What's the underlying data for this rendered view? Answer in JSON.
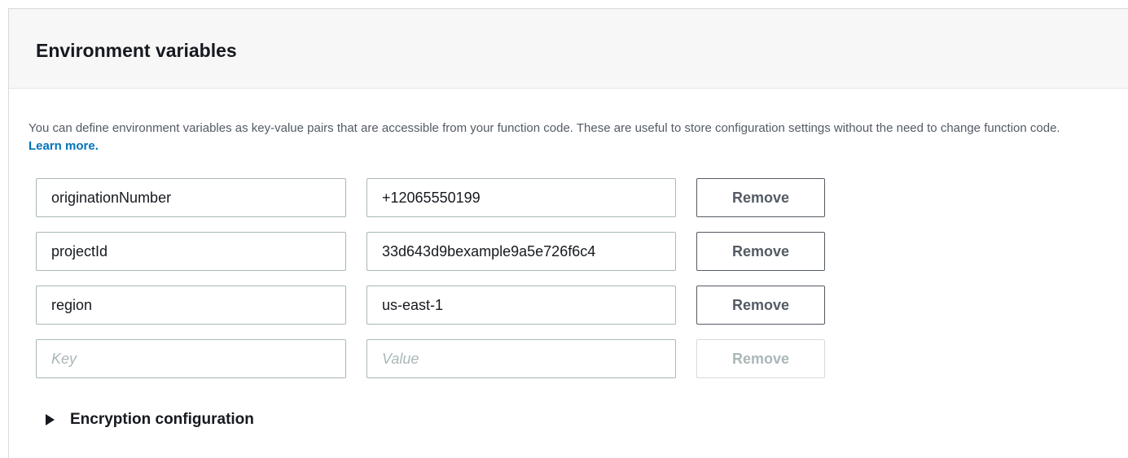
{
  "section": {
    "title": "Environment variables",
    "description": "You can define environment variables as key-value pairs that are accessible from your function code. These are useful to store configuration settings without the need to change function code.",
    "learn_more": "Learn more."
  },
  "variables": [
    {
      "key": "originationNumber",
      "value": "+12065550199",
      "remove_label": "Remove"
    },
    {
      "key": "projectId",
      "value": "33d643d9bexample9a5e726f6c4",
      "remove_label": "Remove"
    },
    {
      "key": "region",
      "value": "us-east-1",
      "remove_label": "Remove"
    }
  ],
  "new_variable": {
    "key_placeholder": "Key",
    "value_placeholder": "Value",
    "remove_label": "Remove"
  },
  "encryption": {
    "label": "Encryption configuration",
    "icon": "caret-right-icon"
  },
  "colors": {
    "link": "#0073bb",
    "header_bg": "#f7f7f7",
    "border": "#aab7b8"
  }
}
